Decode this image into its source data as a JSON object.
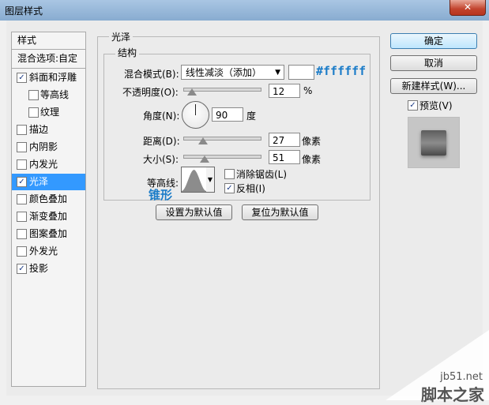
{
  "window": {
    "title": "图层样式",
    "close_glyph": "✕"
  },
  "sidebar": {
    "header": "样式",
    "blend_options": "混合选项:自定",
    "items": [
      {
        "label": "斜面和浮雕",
        "checked": true
      },
      {
        "label": "等高线",
        "checked": false
      },
      {
        "label": "纹理",
        "checked": false
      },
      {
        "label": "描边",
        "checked": false
      },
      {
        "label": "内阴影",
        "checked": false
      },
      {
        "label": "内发光",
        "checked": false
      },
      {
        "label": "光泽",
        "checked": true
      },
      {
        "label": "颜色叠加",
        "checked": false
      },
      {
        "label": "渐变叠加",
        "checked": false
      },
      {
        "label": "图案叠加",
        "checked": false
      },
      {
        "label": "外发光",
        "checked": false
      },
      {
        "label": "投影",
        "checked": true
      }
    ],
    "check_glyph": "✓",
    "selected_color": "#3399ff"
  },
  "satin": {
    "group_title": "光泽",
    "structure_title": "结构",
    "blend_mode_label": "混合模式(B):",
    "blend_mode_value": "线性减淡（添加）",
    "blend_color": "#ffffff",
    "blend_color_annotation": "#ffffff",
    "opacity_label": "不透明度(O):",
    "opacity_value": "12",
    "opacity_unit": "%",
    "angle_label": "角度(N):",
    "angle_value": "90",
    "angle_unit": "度",
    "distance_label": "距离(D):",
    "distance_value": "27",
    "distance_unit": "像素",
    "size_label": "大小(S):",
    "size_value": "51",
    "size_unit": "像素",
    "contour_label": "等高线:",
    "contour_annotation": "锥形",
    "antialias_label": "消除锯齿(L)",
    "antialias_checked": false,
    "invert_label": "反相(I)",
    "invert_checked": true,
    "set_default_label": "设置为默认值",
    "reset_default_label": "复位为默认值",
    "annotation_color": "#1b7cc8"
  },
  "buttons": {
    "ok": "确定",
    "cancel": "取消",
    "new_style": "新建样式(W)...",
    "preview_label": "预览(V)",
    "preview_checked": true
  },
  "watermark": {
    "url": "jb51.net",
    "name": "脚本之家"
  }
}
